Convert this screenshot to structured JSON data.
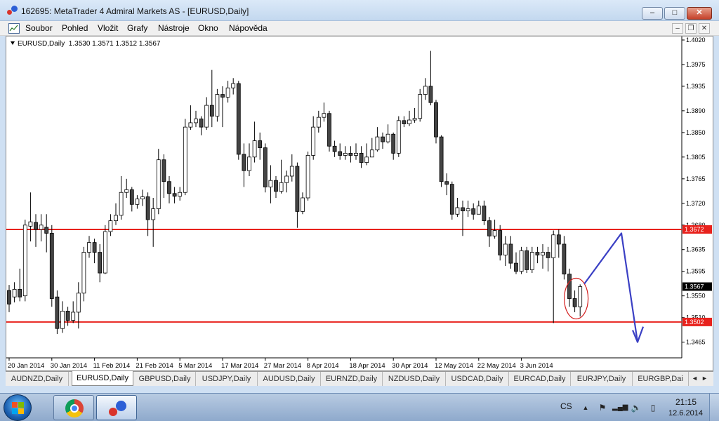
{
  "window": {
    "title": "162695: MetaTrader 4 Admiral Markets AS - [EURUSD,Daily]",
    "buttons": {
      "minimize": "–",
      "maximize": "□",
      "close": "✕"
    }
  },
  "menu": {
    "items": [
      "Soubor",
      "Pohled",
      "Vložit",
      "Grafy",
      "Nástroje",
      "Okno",
      "Nápověda"
    ],
    "mdi_buttons": {
      "minimize": "–",
      "restore": "❐",
      "close": "✕"
    }
  },
  "chart_header": {
    "symbol": "EURUSD,Daily",
    "ohlc": "1.3530 1.3571 1.3512 1.3567"
  },
  "chart_data": {
    "type": "candlestick",
    "symbol": "EURUSD",
    "timeframe": "Daily",
    "price_axis": {
      "range": [
        1.344,
        1.402
      ],
      "ticks": [
        "1.4020",
        "1.3975",
        "1.3935",
        "1.3890",
        "1.3850",
        "1.3805",
        "1.3765",
        "1.3720",
        "1.3680",
        "1.3635",
        "1.3595",
        "1.3550",
        "1.3510",
        "1.3465"
      ]
    },
    "time_axis": {
      "labels": [
        "20 Jan 2014",
        "30 Jan 2014",
        "11 Feb 2014",
        "21 Feb 2014",
        "5 Mar 2014",
        "17 Mar 2014",
        "27 Mar 2014",
        "8 Apr 2014",
        "18 Apr 2014",
        "30 Apr 2014",
        "12 May 2014",
        "22 May 2014",
        "3 Jun 2014"
      ],
      "label_bar_index": [
        0,
        8,
        16,
        24,
        32,
        40,
        48,
        56,
        64,
        72,
        80,
        88,
        96
      ]
    },
    "candles": [
      [
        1.356,
        1.3535,
        1.357,
        1.352
      ],
      [
        1.3548,
        1.3562,
        1.3575,
        1.3538
      ],
      [
        1.3562,
        1.3548,
        1.36,
        1.354
      ],
      [
        1.355,
        1.368,
        1.369,
        1.354
      ],
      [
        1.3678,
        1.3686,
        1.374,
        1.365
      ],
      [
        1.3685,
        1.3672,
        1.37,
        1.364
      ],
      [
        1.3672,
        1.368,
        1.37,
        1.365
      ],
      [
        1.3676,
        1.3665,
        1.37,
        1.363
      ],
      [
        1.3665,
        1.3545,
        1.368,
        1.353
      ],
      [
        1.3548,
        1.349,
        1.356,
        1.348
      ],
      [
        1.349,
        1.3522,
        1.354,
        1.3482
      ],
      [
        1.3522,
        1.3505,
        1.353,
        1.3495
      ],
      [
        1.3505,
        1.352,
        1.354,
        1.35
      ],
      [
        1.352,
        1.3555,
        1.3575,
        1.349
      ],
      [
        1.3555,
        1.363,
        1.364,
        1.354
      ],
      [
        1.363,
        1.3648,
        1.366,
        1.362
      ],
      [
        1.3648,
        1.363,
        1.3655,
        1.361
      ],
      [
        1.363,
        1.3592,
        1.3645,
        1.3575
      ],
      [
        1.3592,
        1.3668,
        1.368,
        1.359
      ],
      [
        1.3668,
        1.3688,
        1.37,
        1.366
      ],
      [
        1.3688,
        1.3698,
        1.372,
        1.368
      ],
      [
        1.3698,
        1.374,
        1.377,
        1.369
      ],
      [
        1.374,
        1.3745,
        1.3765,
        1.373
      ],
      [
        1.3745,
        1.3718,
        1.375,
        1.3705
      ],
      [
        1.3718,
        1.3728,
        1.3735,
        1.371
      ],
      [
        1.3728,
        1.3732,
        1.3745,
        1.3715
      ],
      [
        1.3732,
        1.369,
        1.374,
        1.366
      ],
      [
        1.369,
        1.371,
        1.373,
        1.364
      ],
      [
        1.371,
        1.38,
        1.382,
        1.37
      ],
      [
        1.38,
        1.376,
        1.381,
        1.373
      ],
      [
        1.376,
        1.3738,
        1.377,
        1.372
      ],
      [
        1.3738,
        1.3733,
        1.375,
        1.372
      ],
      [
        1.3733,
        1.374,
        1.375,
        1.3725
      ],
      [
        1.374,
        1.386,
        1.3875,
        1.3735
      ],
      [
        1.386,
        1.3868,
        1.39,
        1.3855
      ],
      [
        1.3868,
        1.3875,
        1.389,
        1.386
      ],
      [
        1.3875,
        1.386,
        1.388,
        1.3845
      ],
      [
        1.386,
        1.39,
        1.3915,
        1.3855
      ],
      [
        1.39,
        1.388,
        1.3965,
        1.386
      ],
      [
        1.388,
        1.392,
        1.393,
        1.387
      ],
      [
        1.392,
        1.3915,
        1.3935,
        1.386
      ],
      [
        1.3915,
        1.3932,
        1.3945,
        1.3905
      ],
      [
        1.3932,
        1.394,
        1.395,
        1.392
      ],
      [
        1.394,
        1.381,
        1.3945,
        1.38
      ],
      [
        1.381,
        1.378,
        1.383,
        1.375
      ],
      [
        1.378,
        1.3805,
        1.383,
        1.377
      ],
      [
        1.3805,
        1.3835,
        1.387,
        1.3795
      ],
      [
        1.3835,
        1.3822,
        1.385,
        1.38
      ],
      [
        1.3822,
        1.375,
        1.383,
        1.374
      ],
      [
        1.375,
        1.3762,
        1.379,
        1.372
      ],
      [
        1.3762,
        1.3742,
        1.377,
        1.373
      ],
      [
        1.3742,
        1.3758,
        1.38,
        1.3738
      ],
      [
        1.3758,
        1.377,
        1.378,
        1.374
      ],
      [
        1.377,
        1.3788,
        1.381,
        1.376
      ],
      [
        1.3788,
        1.3705,
        1.3795,
        1.3675
      ],
      [
        1.3705,
        1.373,
        1.374,
        1.37
      ],
      [
        1.373,
        1.3808,
        1.3815,
        1.3725
      ],
      [
        1.3808,
        1.386,
        1.388,
        1.38
      ],
      [
        1.386,
        1.3878,
        1.389,
        1.385
      ],
      [
        1.3878,
        1.3885,
        1.3905,
        1.387
      ],
      [
        1.3885,
        1.3825,
        1.389,
        1.3815
      ],
      [
        1.3825,
        1.3815,
        1.3835,
        1.3805
      ],
      [
        1.3815,
        1.3808,
        1.383,
        1.38
      ],
      [
        1.3808,
        1.3812,
        1.3825,
        1.38
      ],
      [
        1.3812,
        1.3808,
        1.3825,
        1.3795
      ],
      [
        1.3808,
        1.3812,
        1.383,
        1.38
      ],
      [
        1.3812,
        1.3795,
        1.3825,
        1.3785
      ],
      [
        1.3795,
        1.3805,
        1.383,
        1.379
      ],
      [
        1.3805,
        1.3818,
        1.384,
        1.3805
      ],
      [
        1.3818,
        1.3842,
        1.386,
        1.3815
      ],
      [
        1.3842,
        1.3833,
        1.385,
        1.382
      ],
      [
        1.3833,
        1.3847,
        1.3865,
        1.383
      ],
      [
        1.3847,
        1.3812,
        1.385,
        1.38
      ],
      [
        1.3812,
        1.3872,
        1.388,
        1.3805
      ],
      [
        1.3872,
        1.3866,
        1.388,
        1.386
      ],
      [
        1.3866,
        1.3873,
        1.389,
        1.3862
      ],
      [
        1.3873,
        1.3876,
        1.3895,
        1.3868
      ],
      [
        1.3876,
        1.392,
        1.393,
        1.387
      ],
      [
        1.392,
        1.3935,
        1.395,
        1.391
      ],
      [
        1.3935,
        1.3905,
        1.4,
        1.39
      ],
      [
        1.3905,
        1.3842,
        1.391,
        1.383
      ],
      [
        1.3842,
        1.376,
        1.3845,
        1.375
      ],
      [
        1.376,
        1.3755,
        1.3775,
        1.3735
      ],
      [
        1.3755,
        1.37,
        1.376,
        1.369
      ],
      [
        1.37,
        1.3712,
        1.373,
        1.3695
      ],
      [
        1.3712,
        1.3706,
        1.3725,
        1.366
      ],
      [
        1.3706,
        1.371,
        1.3725,
        1.3695
      ],
      [
        1.371,
        1.37,
        1.372,
        1.369
      ],
      [
        1.37,
        1.3715,
        1.3725,
        1.37
      ],
      [
        1.3715,
        1.3688,
        1.3725,
        1.368
      ],
      [
        1.3688,
        1.366,
        1.3695,
        1.364
      ],
      [
        1.366,
        1.367,
        1.369,
        1.3655
      ],
      [
        1.367,
        1.3625,
        1.368,
        1.3615
      ],
      [
        1.3625,
        1.3645,
        1.366,
        1.3605
      ],
      [
        1.3645,
        1.361,
        1.366,
        1.36
      ],
      [
        1.361,
        1.3595,
        1.363,
        1.359
      ],
      [
        1.3595,
        1.3633,
        1.364,
        1.359
      ],
      [
        1.3633,
        1.3598,
        1.364,
        1.3592
      ],
      [
        1.3598,
        1.363,
        1.364,
        1.3592
      ],
      [
        1.363,
        1.3625,
        1.364,
        1.361
      ],
      [
        1.3625,
        1.363,
        1.3645,
        1.36
      ],
      [
        1.363,
        1.362,
        1.364,
        1.3595
      ],
      [
        1.362,
        1.3662,
        1.367,
        1.35
      ],
      [
        1.3662,
        1.3645,
        1.3672,
        1.362
      ],
      [
        1.3645,
        1.359,
        1.366,
        1.358
      ],
      [
        1.359,
        1.3545,
        1.36,
        1.353
      ],
      [
        1.3545,
        1.353,
        1.356,
        1.352
      ],
      [
        1.353,
        1.3567,
        1.3571,
        1.3512
      ]
    ],
    "horizontal_lines": [
      {
        "price": 1.3672,
        "label": "1.3672",
        "color": "#e8221d"
      },
      {
        "price": 1.3502,
        "label": "1.3502",
        "color": "#e8221d"
      }
    ],
    "current_price": {
      "price": 1.3567,
      "label": "1.3567"
    },
    "annotation_color": "#3b40c4",
    "annotations": "hand-drawn red circle around last candles; blue arrow up then down"
  },
  "tabs": {
    "items": [
      "AUDNZD,Daily",
      "EURUSD,Daily",
      "GBPUSD,Daily",
      "USDJPY,Daily",
      "AUDUSD,Daily",
      "EURNZD,Daily",
      "NZDUSD,Daily",
      "USDCAD,Daily",
      "EURCAD,Daily",
      "EURJPY,Daily",
      "EURGBP,Dai"
    ],
    "active_index": 1,
    "scroll_left": "◄",
    "scroll_right": "►"
  },
  "taskbar": {
    "language": "CS",
    "time": "21:15",
    "date": "12.6.2014",
    "tray_icons": [
      "up-arrow-icon",
      "flag-icon",
      "network-icon",
      "volume-icon",
      "battery-icon"
    ],
    "tray_glyphs": [
      "▲",
      "⚑",
      "▂▄▆",
      "🔈",
      "▯"
    ]
  }
}
